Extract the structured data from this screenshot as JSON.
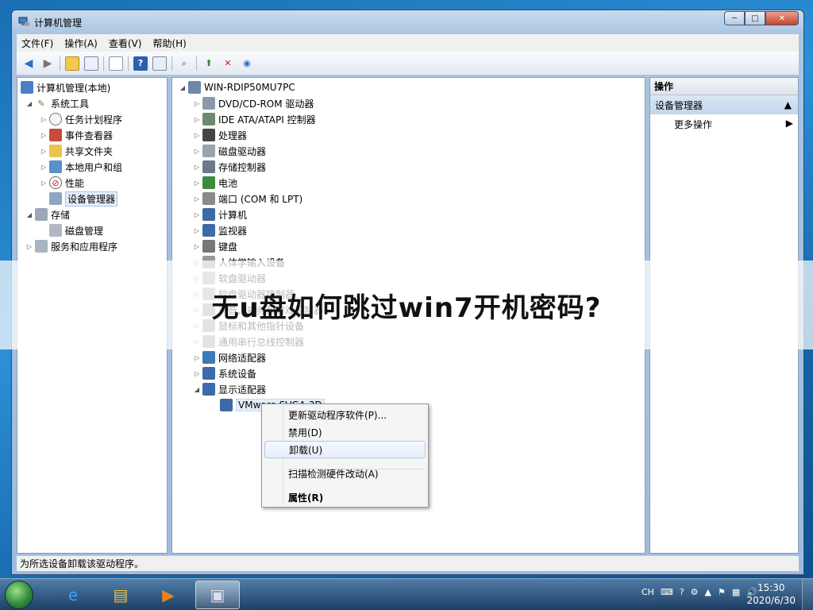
{
  "window": {
    "title": "计算机管理"
  },
  "window_buttons": {
    "minimize": "─",
    "maximize": "□",
    "close": "✕"
  },
  "menu": [
    "文件(F)",
    "操作(A)",
    "查看(V)",
    "帮助(H)"
  ],
  "left_tree": [
    {
      "label": "计算机管理(本地)",
      "level": 0,
      "arrow": "",
      "icon": "computer-management-icon"
    },
    {
      "label": "系统工具",
      "level": 1,
      "arrow": "◢",
      "icon": "tools-icon"
    },
    {
      "label": "任务计划程序",
      "level": 2,
      "arrow": "▷",
      "icon": "clock-icon"
    },
    {
      "label": "事件查看器",
      "level": 2,
      "arrow": "▷",
      "icon": "event-viewer-icon"
    },
    {
      "label": "共享文件夹",
      "level": 2,
      "arrow": "▷",
      "icon": "shared-folder-icon"
    },
    {
      "label": "本地用户和组",
      "level": 2,
      "arrow": "▷",
      "icon": "users-icon"
    },
    {
      "label": "性能",
      "level": 2,
      "arrow": "▷",
      "icon": "performance-icon"
    },
    {
      "label": "设备管理器",
      "level": 2,
      "arrow": "",
      "icon": "device-manager-icon",
      "selected": true
    },
    {
      "label": "存储",
      "level": 1,
      "arrow": "◢",
      "icon": "storage-icon"
    },
    {
      "label": "磁盘管理",
      "level": 2,
      "arrow": "",
      "icon": "disk-icon"
    },
    {
      "label": "服务和应用程序",
      "level": 1,
      "arrow": "▷",
      "icon": "services-icon"
    }
  ],
  "device_tree": {
    "root": "WIN-RDIP50MU7PC",
    "items": [
      {
        "label": "DVD/CD-ROM 驱动器",
        "icon": "dvd-icon"
      },
      {
        "label": "IDE ATA/ATAPI 控制器",
        "icon": "ide-controller-icon"
      },
      {
        "label": "处理器",
        "icon": "processor-icon"
      },
      {
        "label": "磁盘驱动器",
        "icon": "disk-drive-icon"
      },
      {
        "label": "存储控制器",
        "icon": "storage-controller-icon"
      },
      {
        "label": "电池",
        "icon": "battery-icon"
      },
      {
        "label": "端口 (COM 和 LPT)",
        "icon": "port-icon"
      },
      {
        "label": "计算机",
        "icon": "computer-icon"
      },
      {
        "label": "监视器",
        "icon": "monitor-icon"
      },
      {
        "label": "键盘",
        "icon": "keyboard-icon"
      },
      {
        "label": "人体学输入设备",
        "icon": "hid-icon"
      },
      {
        "label": "软盘驱动器",
        "icon": "floppy-icon"
      },
      {
        "label": "软盘驱动器控制器",
        "icon": "floppy-controller-icon"
      },
      {
        "label": "声音、视频和游戏控制器",
        "icon": "sound-icon"
      },
      {
        "label": "鼠标和其他指针设备",
        "icon": "mouse-icon"
      },
      {
        "label": "通用串行总线控制器",
        "icon": "usb-icon"
      },
      {
        "label": "网络适配器",
        "icon": "network-adapter-icon"
      },
      {
        "label": "系统设备",
        "icon": "system-device-icon"
      },
      {
        "label": "显示适配器",
        "icon": "display-adapter-icon",
        "expanded": true
      }
    ],
    "child": "VMware SVGA 3D"
  },
  "actions": {
    "header": "操作",
    "section": "设备管理器",
    "more": "更多操作"
  },
  "context_menu": {
    "update": "更新驱动程序软件(P)...",
    "disable": "禁用(D)",
    "uninstall": "卸载(U)",
    "scan": "扫描检测硬件改动(A)",
    "properties": "属性(R)"
  },
  "status": "为所选设备卸载该驱动程序。",
  "overlay": "无u盘如何跳过win7开机密码?",
  "taskbar": {
    "lang": "CH",
    "time": "15:30",
    "date": "2020/6/30"
  }
}
